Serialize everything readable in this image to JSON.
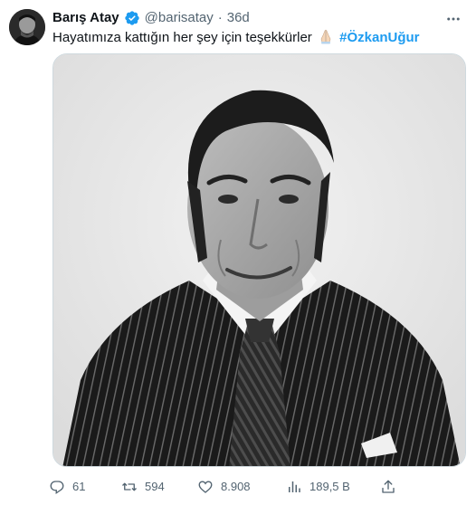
{
  "tweet": {
    "author_name": "Barış Atay",
    "handle": "@barisatay",
    "separator": "·",
    "time": "36d",
    "text_before": "Hayatımıza kattığın her şey için teşekkürler",
    "hashtag": "#ÖzkanUğur",
    "emoji": "folded-hands-emoji",
    "verified": true
  },
  "actions": {
    "replies": "61",
    "retweets": "594",
    "likes": "8.908",
    "views": "189,5 B"
  },
  "icons": {
    "more": "more-icon",
    "reply": "reply-icon",
    "retweet": "retweet-icon",
    "like": "heart-icon",
    "views": "views-icon",
    "share": "share-icon"
  },
  "colors": {
    "accent": "#1d9bf0",
    "text": "#0f1419",
    "muted": "#536471",
    "border": "#cfd9de"
  }
}
